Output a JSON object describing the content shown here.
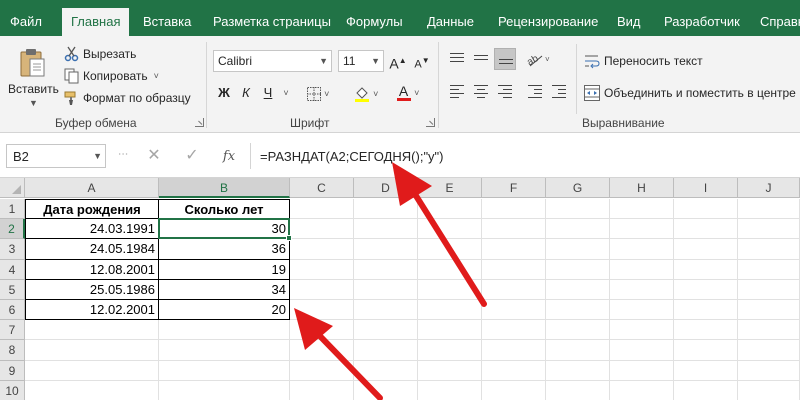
{
  "tabs": [
    {
      "label": "Файл",
      "active": false
    },
    {
      "label": "Главная",
      "active": true
    },
    {
      "label": "Вставка",
      "active": false
    },
    {
      "label": "Разметка страницы",
      "active": false
    },
    {
      "label": "Формулы",
      "active": false
    },
    {
      "label": "Данные",
      "active": false
    },
    {
      "label": "Рецензирование",
      "active": false
    },
    {
      "label": "Вид",
      "active": false
    },
    {
      "label": "Разработчик",
      "active": false
    },
    {
      "label": "Справк",
      "active": false
    }
  ],
  "clipboard": {
    "paste_label": "Вставить",
    "cut_label": "Вырезать",
    "copy_label": "Копировать",
    "format_painter_label": "Формат по образцу",
    "group_label": "Буфер обмена"
  },
  "font": {
    "name": "Calibri",
    "size": "11",
    "bold_label": "Ж",
    "italic_label": "К",
    "underline_label": "Ч",
    "grow_label": "A",
    "shrink_label": "A",
    "font_color_label": "A",
    "group_label": "Шрифт"
  },
  "alignment": {
    "wrap_label": "Переносить текст",
    "merge_label": "Объединить и поместить в центре",
    "group_label": "Выравнивание"
  },
  "formula_bar": {
    "name_box": "B2",
    "fx_label": "fx",
    "cancel_label": "✕",
    "enter_label": "✓",
    "formula": "=РАЗНДАТ(A2;СЕГОДНЯ();\"y\")"
  },
  "grid": {
    "columns": [
      "A",
      "B",
      "C",
      "D",
      "E",
      "F",
      "G",
      "H",
      "I",
      "J"
    ],
    "rows": [
      "1",
      "2",
      "3",
      "4",
      "5",
      "6",
      "7",
      "8",
      "9",
      "10"
    ],
    "selected_cell": "B2",
    "header_row": [
      "Дата рождения",
      "Сколько лет"
    ],
    "data": [
      [
        "24.03.1991",
        "30"
      ],
      [
        "24.05.1984",
        "36"
      ],
      [
        "12.08.2001",
        "19"
      ],
      [
        "25.05.1986",
        "34"
      ],
      [
        "12.02.2001",
        "20"
      ]
    ]
  },
  "colors": {
    "excel_green": "#217346",
    "annotation_red": "#e01b1b"
  }
}
